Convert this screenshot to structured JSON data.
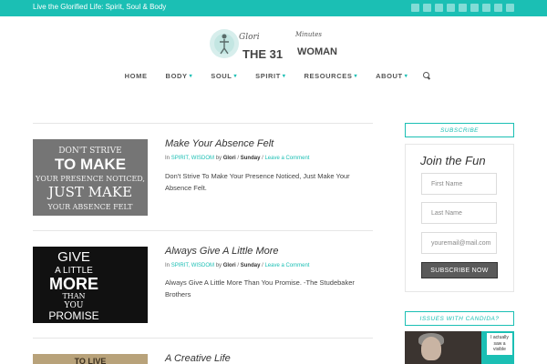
{
  "topbar": {
    "tagline": "Live the Glorified Life: Spirit, Soul & Body",
    "social_icons": [
      "facebook-icon",
      "twitter-icon",
      "google-plus-icon",
      "linkedin-icon",
      "youtube-icon",
      "instagram-icon",
      "pinterest-icon",
      "tumblr-icon",
      "rss-icon"
    ]
  },
  "logo": {
    "text_main": "THE 31",
    "text_sub": "WOMAN",
    "script_left": "Glori",
    "script_right": "Minutes"
  },
  "nav": {
    "items": [
      "HOME",
      "BODY",
      "SOUL",
      "SPIRIT",
      "RESOURCES",
      "ABOUT"
    ],
    "has_dropdown": [
      false,
      true,
      true,
      true,
      true,
      true
    ]
  },
  "posts": [
    {
      "title": "Make Your Absence Felt",
      "meta_prefix": "In",
      "categories": "SPIRIT, WISDOM",
      "by": "by",
      "author": "Glori",
      "day": "Sunday",
      "comment": "Leave a Comment",
      "excerpt": "Don't Strive To Make Your Presence Noticed, Just Make Your Absence Felt.",
      "image_lines": [
        "DON'T STRIVE",
        "TO MAKE",
        "YOUR PRESENCE NOTICED,",
        "JUST MAKE",
        "YOUR ABSENCE FELT"
      ]
    },
    {
      "title": "Always Give A Little More",
      "meta_prefix": "In",
      "categories": "SPIRIT, WISDOM",
      "by": "by",
      "author": "Glori",
      "day": "Sunday",
      "comment": "Leave a Comment",
      "excerpt": "Always Give A Little More Than You Promise. -The Studebaker Brothers",
      "image_lines": [
        "GIVE",
        "A LITTLE",
        "MORE",
        "THAN",
        "YOU",
        "PROMISE"
      ]
    },
    {
      "title": "A Creative Life",
      "image_lines": [
        "TO LIVE"
      ]
    }
  ],
  "sidebar": {
    "subscribe_header": "SUBSCRIBE",
    "join_title": "Join the Fun",
    "first_name_placeholder": "First Name",
    "last_name_placeholder": "Last Name",
    "email_placeholder": "youremail@mail.com",
    "subscribe_button": "SUBSCRIBE NOW",
    "candida_header": "ISSUES WITH CANDIDA?",
    "candida_callout": "I actually saw a visible"
  },
  "colors": {
    "accent": "#1bbfb4",
    "text": "#333333",
    "button": "#5a5a5a"
  }
}
